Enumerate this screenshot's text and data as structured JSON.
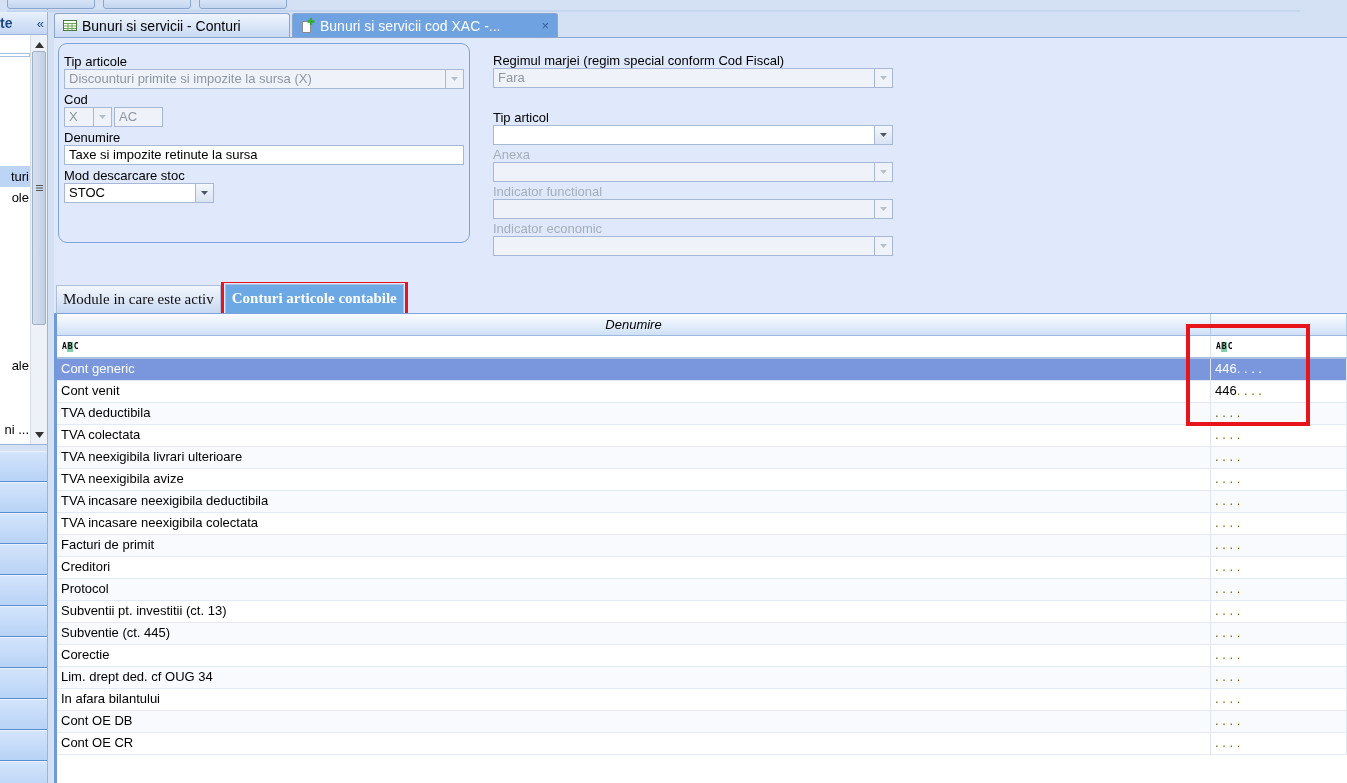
{
  "sidebar": {
    "header": "te",
    "collapse": "«",
    "items": [
      {
        "label": "turi",
        "selected": true
      },
      {
        "label": "ole",
        "selected": false
      },
      {
        "label": "ale",
        "selected": false
      },
      {
        "label": "ni ...",
        "selected": false
      }
    ]
  },
  "document_tabs": [
    {
      "label": "Bunuri si servicii - Conturi",
      "selected": false
    },
    {
      "label": "Bunuri si servicii cod XAC -...",
      "selected": true,
      "close": "×"
    }
  ],
  "form": {
    "left": [
      {
        "label": "Tip articole",
        "kind": "combo",
        "value": "Discounturi primite si impozite la sursa (X)",
        "read_only": true,
        "disabled": false
      },
      {
        "label": "Cod",
        "kind": "code",
        "value": "X",
        "suffix": "AC",
        "read_only": true,
        "disabled": false
      },
      {
        "label": "Denumire",
        "kind": "text",
        "value": "Taxe si impozite retinute la sursa",
        "read_only": false,
        "disabled": false
      },
      {
        "label": "Mod descarcare stoc",
        "kind": "short-combo",
        "value": "STOC",
        "read_only": false,
        "disabled": false
      }
    ],
    "right": [
      {
        "label": "Regimul marjei (regim special conform Cod Fiscal)",
        "kind": "combo",
        "value": "Fara",
        "read_only": true,
        "disabled": false
      },
      {
        "label": "Tip articol",
        "kind": "combo",
        "read_only": false,
        "disabled": false
      },
      {
        "label": "Anexa",
        "kind": "combo",
        "read_only": false,
        "disabled": true
      },
      {
        "label": "Indicator functional",
        "kind": "combo",
        "read_only": false,
        "disabled": true
      },
      {
        "label": "Indicator economic",
        "kind": "combo",
        "read_only": false,
        "disabled": true
      }
    ]
  },
  "sub_tabs": [
    {
      "label": "Module in care este activ",
      "selected": false,
      "highlighted": false
    },
    {
      "label": "Conturi articole contabile",
      "selected": true,
      "highlighted": true
    }
  ],
  "grid": {
    "columns": [
      {
        "heading": "Denumire",
        "filter": "ABC"
      },
      {
        "filter": "ABC",
        "highlighted": true
      }
    ],
    "rows": [
      {
        "name": "Cont generic",
        "account": "446",
        "mask": ". . . .",
        "selected": true
      },
      {
        "name": "Cont venit",
        "account": "446",
        "mask": ". . . .",
        "selected": false
      },
      {
        "name": "TVA deductibila",
        "mask": ". . . .",
        "selected": false
      },
      {
        "name": "TVA colectata",
        "mask": ". . . .",
        "selected": false
      },
      {
        "name": "TVA neexigibila livrari ulterioare",
        "mask": ". . . .",
        "selected": false
      },
      {
        "name": "TVA neexigibila avize",
        "mask": ". . . .",
        "selected": false
      },
      {
        "name": "TVA incasare neexigibila deductibila",
        "mask": ". . . .",
        "selected": false
      },
      {
        "name": "TVA incasare neexigibila colectata",
        "mask": ". . . .",
        "selected": false
      },
      {
        "name": "Facturi de primit",
        "mask": ". . . .",
        "selected": false
      },
      {
        "name": "Creditori",
        "mask": ". . . .",
        "selected": false
      },
      {
        "name": "Protocol",
        "mask": ". . . .",
        "selected": false
      },
      {
        "name": "Subventii pt. investitii (ct. 13)",
        "mask": ". . . .",
        "selected": false
      },
      {
        "name": "Subventie (ct. 445)",
        "mask": ". . . .",
        "selected": false
      },
      {
        "name": "Corectie",
        "mask": ". . . .",
        "selected": false
      },
      {
        "name": "Lim. drept ded. cf OUG 34",
        "mask": ". . . .",
        "selected": false
      },
      {
        "name": "In afara bilantului",
        "mask": ". . . .",
        "selected": false
      },
      {
        "name": "Cont OE DB",
        "mask": ". . . .",
        "selected": false
      },
      {
        "name": "Cont OE CR",
        "mask": ". . . .",
        "selected": false
      }
    ]
  }
}
